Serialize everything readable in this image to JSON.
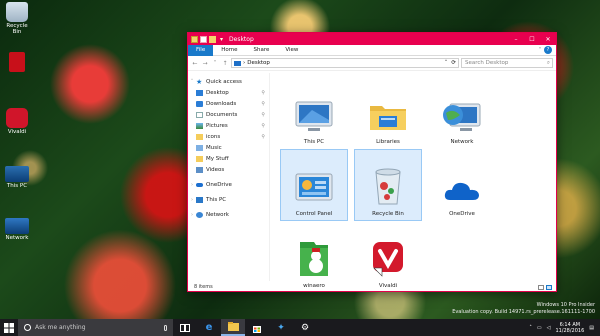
{
  "desktop": {
    "icons": [
      {
        "label": "Recycle Bin"
      },
      {
        "label": ""
      },
      {
        "label": "Vivaldi"
      },
      {
        "label": "This PC"
      },
      {
        "label": "Network"
      }
    ]
  },
  "window": {
    "title": "Desktop",
    "accent_color": "#e8004f",
    "controls": {
      "minimize": "–",
      "maximize": "☐",
      "close": "✕"
    },
    "ribbon_tabs": [
      "File",
      "Home",
      "Share",
      "View"
    ],
    "help": "?",
    "address": {
      "path": "Desktop",
      "search_placeholder": "Search Desktop"
    },
    "nav_pane": [
      {
        "label": "Quick access",
        "icon": "star-icon"
      },
      {
        "label": "Desktop",
        "icon": "desktop-icon",
        "pinned": true
      },
      {
        "label": "Downloads",
        "icon": "download-icon",
        "pinned": true
      },
      {
        "label": "Documents",
        "icon": "document-icon",
        "pinned": true
      },
      {
        "label": "Pictures",
        "icon": "pictures-icon",
        "pinned": true
      },
      {
        "label": "icons",
        "icon": "folder-icon",
        "pinned": true
      },
      {
        "label": "Music",
        "icon": "music-icon"
      },
      {
        "label": "My Stuff",
        "icon": "folder-icon"
      },
      {
        "label": "Videos",
        "icon": "video-icon"
      },
      {
        "label": "OneDrive",
        "icon": "onedrive-icon"
      },
      {
        "label": "This PC",
        "icon": "computer-icon"
      },
      {
        "label": "Network",
        "icon": "network-icon"
      }
    ],
    "items": [
      {
        "label": "This PC",
        "icon": "computer-icon"
      },
      {
        "label": "Libraries",
        "icon": "libraries-icon"
      },
      {
        "label": "Network",
        "icon": "network-icon"
      },
      {
        "label": "Control Panel",
        "icon": "control-panel-icon",
        "selected": true
      },
      {
        "label": "Recycle Bin",
        "icon": "recycle-bin-icon",
        "selected": true
      },
      {
        "label": "OneDrive",
        "icon": "onedrive-icon"
      },
      {
        "label": "winaero",
        "icon": "winaero-icon"
      },
      {
        "label": "Vivaldi",
        "icon": "vivaldi-icon"
      }
    ],
    "status": "8 items"
  },
  "watermark": {
    "line1": "Windows 10 Pro Insider",
    "line2": "Evaluation copy. Build 14971.rs_prerelease.161111-1700"
  },
  "taskbar": {
    "search_placeholder": "Ask me anything",
    "time": "6:14 AM",
    "date": "11/28/2016"
  }
}
